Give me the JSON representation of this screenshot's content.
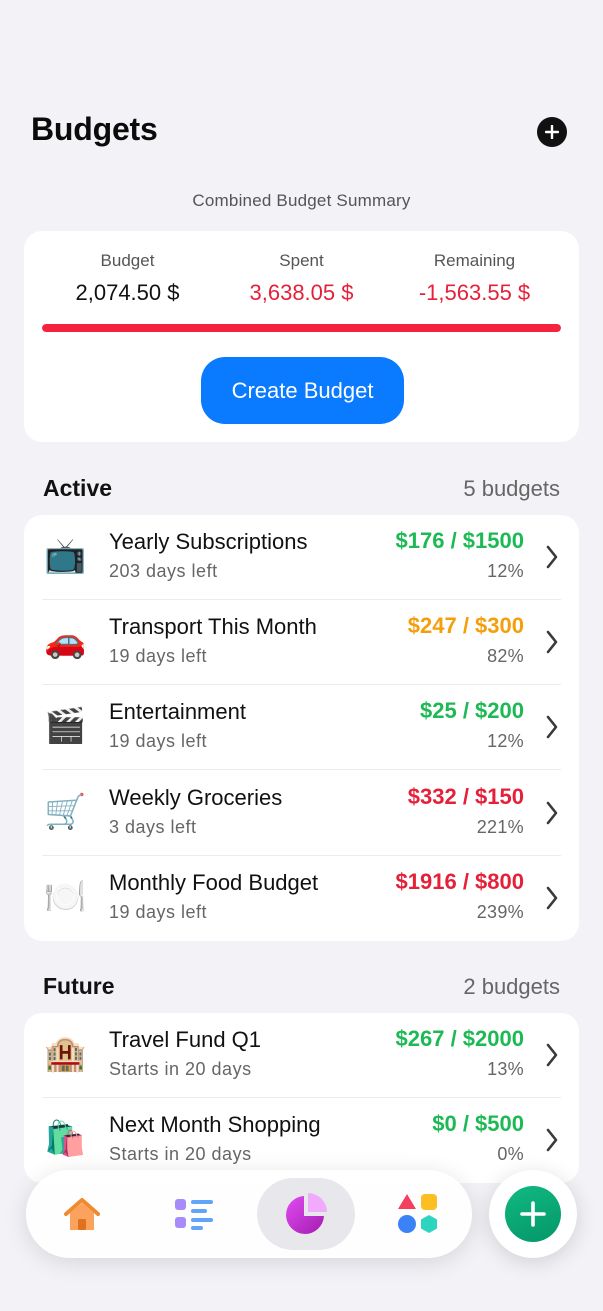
{
  "header": {
    "title": "Budgets",
    "add_icon": "plus-circle-icon"
  },
  "summary": {
    "heading": "Combined Budget Summary",
    "budget_label": "Budget",
    "budget_value": "2,074.50 $",
    "spent_label": "Spent",
    "spent_value": "3,638.05 $",
    "remaining_label": "Remaining",
    "remaining_value": "-1,563.55 $",
    "progress_fraction": 1.0,
    "create_button_label": "Create Budget"
  },
  "active": {
    "title": "Active",
    "count": "5 budgets",
    "items": [
      {
        "icon": "📺",
        "icon_name": "television-icon",
        "name": "Yearly Subscriptions",
        "subtitle": "203 days left",
        "amount": "$176 / $1500",
        "percent": "12%",
        "amount_color": "#1DB954"
      },
      {
        "icon": "🚗",
        "icon_name": "car-icon",
        "name": "Transport This Month",
        "subtitle": "19 days left",
        "amount": "$247 / $300",
        "percent": "82%",
        "amount_color": "#F59E0B"
      },
      {
        "icon": "🎬",
        "icon_name": "clapper-board-icon",
        "name": "Entertainment",
        "subtitle": "19 days left",
        "amount": "$25 / $200",
        "percent": "12%",
        "amount_color": "#1DB954"
      },
      {
        "icon": "🛒",
        "icon_name": "shopping-cart-icon",
        "name": "Weekly Groceries",
        "subtitle": "3 days left",
        "amount": "$332 / $150",
        "percent": "221%",
        "amount_color": "#E5213A"
      },
      {
        "icon": "🍽️",
        "icon_name": "plate-utensils-icon",
        "name": "Monthly Food Budget",
        "subtitle": "19 days left",
        "amount": "$1916 / $800",
        "percent": "239%",
        "amount_color": "#E5213A"
      }
    ]
  },
  "future": {
    "title": "Future",
    "count": "2 budgets",
    "items": [
      {
        "icon": "🏨",
        "icon_name": "hotel-icon",
        "name": "Travel Fund Q1",
        "subtitle": "Starts in 20 days",
        "amount": "$267 / $2000",
        "percent": "13%",
        "amount_color": "#1DB954"
      },
      {
        "icon": "🛍️",
        "icon_name": "shopping-bags-icon",
        "name": "Next Month Shopping",
        "subtitle": "Starts in 20 days",
        "amount": "$0 / $500",
        "percent": "0%",
        "amount_color": "#1DB954"
      }
    ]
  },
  "tabbar": {
    "tabs": [
      {
        "icon_name": "home-icon",
        "active": false
      },
      {
        "icon_name": "list-icon",
        "active": false
      },
      {
        "icon_name": "pie-chart-icon",
        "active": true
      },
      {
        "icon_name": "shapes-icon",
        "active": false
      }
    ],
    "fab_icon": "plus-icon"
  },
  "colors": {
    "accent_blue": "#0A7AFF",
    "positive_green": "#1DB954",
    "warning_orange": "#F59E0B",
    "over_red": "#E5213A",
    "fab_green": "#10B981",
    "pie_purple": "#C026D3"
  }
}
